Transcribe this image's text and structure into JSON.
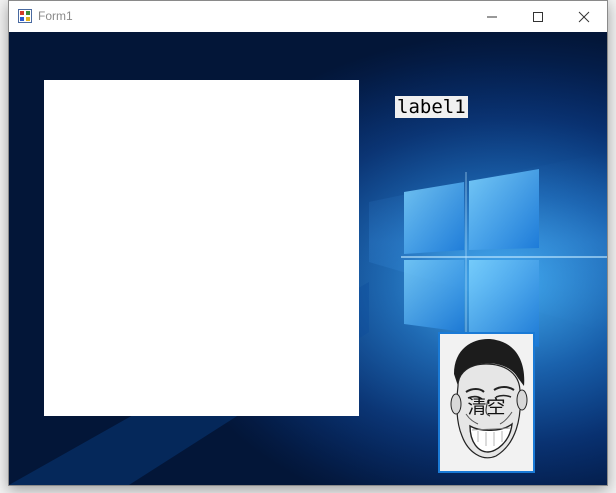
{
  "window": {
    "title": "Form1"
  },
  "controls": {
    "minimize_icon": "minimize-icon",
    "maximize_icon": "maximize-icon",
    "close_icon": "close-icon"
  },
  "form": {
    "label1_text": "label1",
    "clear_button_text": "清空",
    "clear_button_image": "troll-face-image"
  },
  "colors": {
    "accent": "#1a7ad6",
    "wallpaper_dark": "#031638",
    "wallpaper_light": "#2a8fe0"
  }
}
